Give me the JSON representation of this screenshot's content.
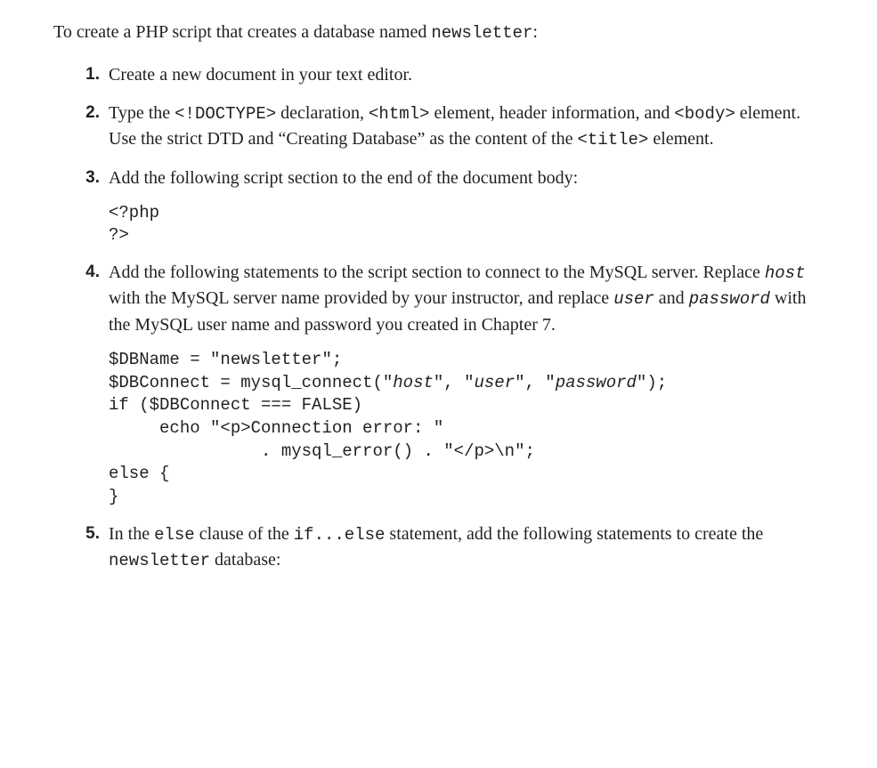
{
  "intro": {
    "pre": "To create a PHP script that creates a database named ",
    "code": "newsletter",
    "post": ":"
  },
  "steps": [
    {
      "num": "1.",
      "parts": [
        {
          "t": "text",
          "v": "Create a new document in your text editor."
        }
      ]
    },
    {
      "num": "2.",
      "parts": [
        {
          "t": "text",
          "v": "Type the "
        },
        {
          "t": "code",
          "v": "<!DOCTYPE>"
        },
        {
          "t": "text",
          "v": " declaration, "
        },
        {
          "t": "code",
          "v": "<html>"
        },
        {
          "t": "text",
          "v": " element, header infor­mation, and "
        },
        {
          "t": "code",
          "v": "<body>"
        },
        {
          "t": "text",
          "v": " element. Use the strict DTD and “Creating Database” as the content of the "
        },
        {
          "t": "code",
          "v": "<title>"
        },
        {
          "t": "text",
          "v": " element."
        }
      ]
    },
    {
      "num": "3.",
      "parts": [
        {
          "t": "text",
          "v": "Add the following script section to the end of the document body:"
        }
      ],
      "code": [
        {
          "t": "code",
          "v": "<?php\n?>"
        }
      ]
    },
    {
      "num": "4.",
      "parts": [
        {
          "t": "text",
          "v": "Add the following statements to the script section to connect to the MySQL server. Replace "
        },
        {
          "t": "codeit",
          "v": "host"
        },
        {
          "t": "text",
          "v": " with the MySQL server name provided by your instructor, and replace "
        },
        {
          "t": "codeit",
          "v": "user"
        },
        {
          "t": "text",
          "v": " and "
        },
        {
          "t": "codeit",
          "v": "password"
        },
        {
          "t": "text",
          "v": " with the MySQL user name and password you created in Chapter 7."
        }
      ],
      "code": [
        {
          "t": "code",
          "v": "$DBName = \"newsletter\";\n$DBConnect = mysql_connect(\""
        },
        {
          "t": "codeit",
          "v": "host"
        },
        {
          "t": "code",
          "v": "\", \""
        },
        {
          "t": "codeit",
          "v": "user"
        },
        {
          "t": "code",
          "v": "\", \""
        },
        {
          "t": "codeit",
          "v": "password"
        },
        {
          "t": "code",
          "v": "\");\nif ($DBConnect === FALSE)\n     echo \"<p>Connection error: \"\n               . mysql_error() . \"</p>\\n\";\nelse {\n}"
        }
      ]
    },
    {
      "num": "5.",
      "parts": [
        {
          "t": "text",
          "v": "In the "
        },
        {
          "t": "code",
          "v": "else"
        },
        {
          "t": "text",
          "v": " clause of the "
        },
        {
          "t": "code",
          "v": "if...else"
        },
        {
          "t": "text",
          "v": " statement, add the follow­ing statements to create the "
        },
        {
          "t": "code",
          "v": "newsletter"
        },
        {
          "t": "text",
          "v": " database:"
        }
      ]
    }
  ]
}
